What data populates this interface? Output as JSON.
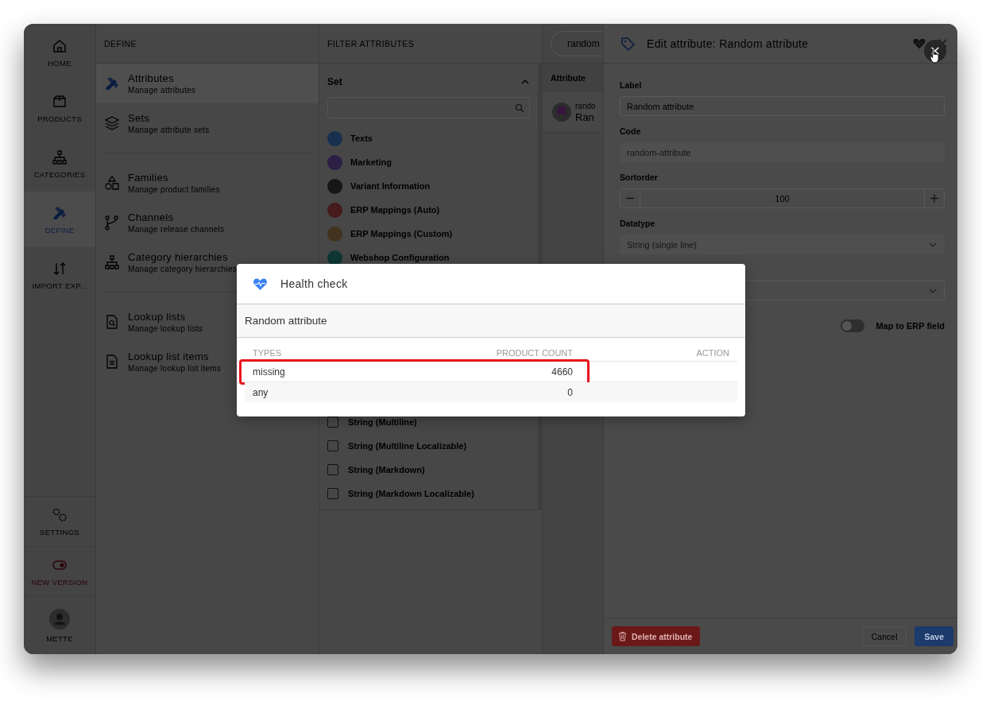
{
  "rail": {
    "items": [
      {
        "label": "HOME",
        "selected": false
      },
      {
        "label": "PRODUCTS",
        "selected": false
      },
      {
        "label": "CATEGORIES",
        "selected": false
      },
      {
        "label": "DEFINE",
        "selected": true
      },
      {
        "label": "IMPORT EXP...",
        "selected": false
      }
    ],
    "bottom_items": [
      {
        "label": "SETTINGS",
        "kind": "settings"
      },
      {
        "label": "NEW VERSION",
        "kind": "version"
      },
      {
        "label": "METTE",
        "kind": "user"
      }
    ]
  },
  "define_menu": {
    "header": "DEFINE",
    "groups": [
      [
        {
          "title": "Attributes",
          "subtitle": "Manage attributes",
          "selected": true
        },
        {
          "title": "Sets",
          "subtitle": "Manage attribute sets",
          "selected": false
        }
      ],
      [
        {
          "title": "Families",
          "subtitle": "Manage product families",
          "selected": false
        },
        {
          "title": "Channels",
          "subtitle": "Manage release channels",
          "selected": false
        },
        {
          "title": "Category hierarchies",
          "subtitle": "Manage category hierarchies",
          "selected": false
        }
      ],
      [
        {
          "title": "Lookup lists",
          "subtitle": "Manage lookup lists",
          "selected": false
        },
        {
          "title": "Lookup list items",
          "subtitle": "Manage lookup list items",
          "selected": false
        }
      ]
    ]
  },
  "filter": {
    "header": "FILTER ATTRIBUTES",
    "section": {
      "title": "Set",
      "expanded": true
    },
    "sets": [
      {
        "label": "Texts",
        "color": "#17304f"
      },
      {
        "label": "Marketing",
        "color": "#2b1f45"
      },
      {
        "label": "Variant Information",
        "color": "#161616"
      },
      {
        "label": "ERP Mappings (Auto)",
        "color": "#451b1b"
      },
      {
        "label": "ERP Mappings (Custom)",
        "color": "#41331f"
      },
      {
        "label": "Webshop Configuration",
        "color": "#0e3734"
      }
    ],
    "datatypes": [
      {
        "label": "String (Multiline)",
        "checked": false
      },
      {
        "label": "String (Multiline Localizable)",
        "checked": false
      },
      {
        "label": "String (Markdown)",
        "checked": false
      },
      {
        "label": "String (Markdown Localizable)",
        "checked": false
      }
    ]
  },
  "list": {
    "search": {
      "value": "random"
    },
    "column": "Attribute",
    "rows": [
      {
        "code": "rando",
        "name": "Ran"
      }
    ]
  },
  "editor": {
    "title": "Edit attribute: Random attribute",
    "fields": [
      {
        "kind": "text",
        "label": "Label",
        "value": "Random attribute",
        "disabled": false
      },
      {
        "kind": "text",
        "label": "Code",
        "value": "random-attribute",
        "disabled": true
      },
      {
        "kind": "stepper",
        "label": "Sortorder",
        "value": "100"
      },
      {
        "kind": "select",
        "label": "Datatype",
        "value": "String (single line)",
        "disabled": true
      },
      {
        "kind": "select"
      }
    ],
    "toggle": {
      "label": "Map to ERP field",
      "on": false
    },
    "buttons": {
      "delete": "Delete attribute",
      "cancel": "Cancel",
      "save": "Save"
    }
  },
  "health_check": {
    "title": "Health check",
    "subtitle": "Random attribute",
    "columns": [
      "TYPES",
      "PRODUCT COUNT",
      "ACTION"
    ],
    "rows": [
      {
        "type": "missing",
        "count": "4660",
        "highlighted": true
      },
      {
        "type": "any",
        "count": "0",
        "highlighted": false
      }
    ]
  }
}
